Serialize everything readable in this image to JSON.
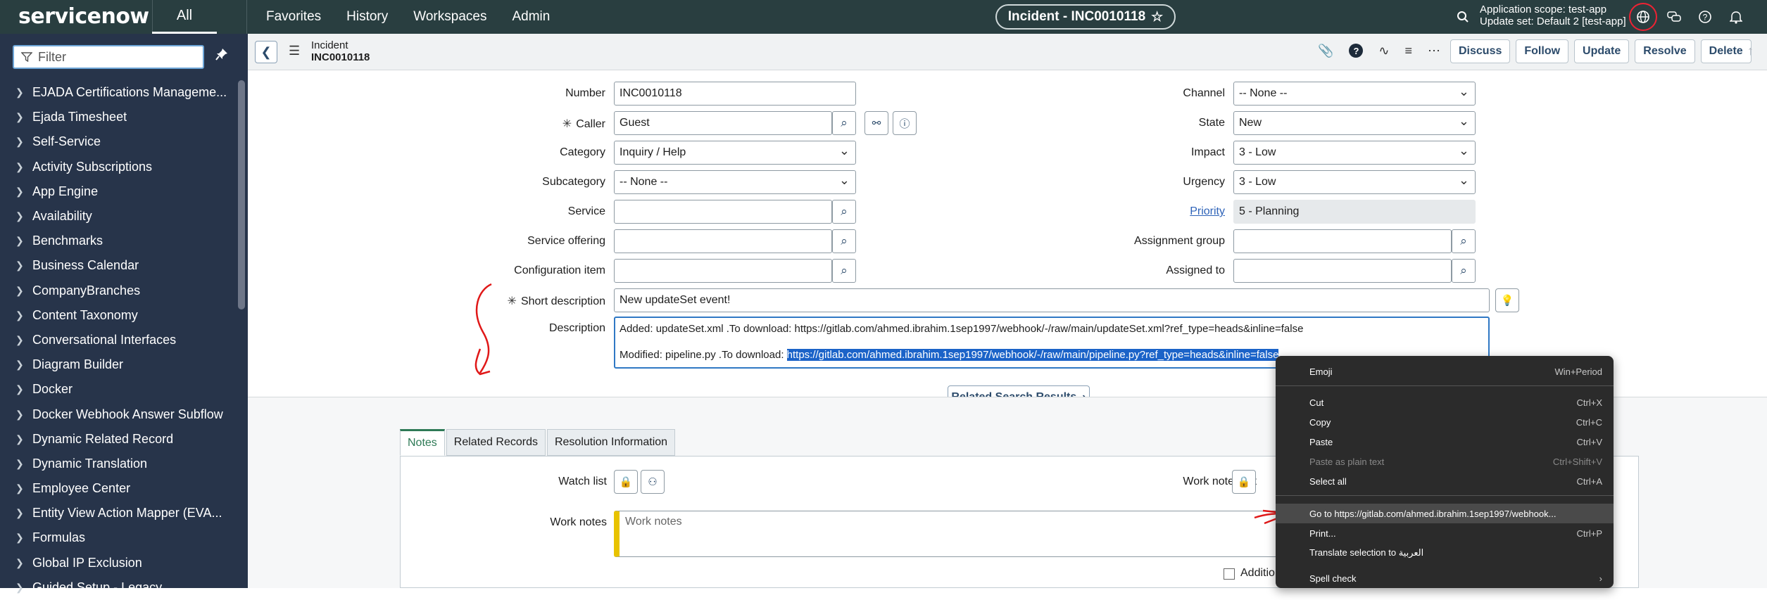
{
  "topbar": {
    "logo": "servicenow",
    "all_tab": "All",
    "nav": [
      "Favorites",
      "History",
      "Workspaces",
      "Admin"
    ],
    "record_pill": "Incident - INC0010118",
    "scope_line1": "Application scope: test-app",
    "scope_line2": "Update set: Default 2 [test-app]"
  },
  "sidebar": {
    "filter_placeholder": "Filter",
    "items": [
      "EJADA Certifications Manageme...",
      "Ejada Timesheet",
      "Self-Service",
      "Activity Subscriptions",
      "App Engine",
      "Availability",
      "Benchmarks",
      "Business Calendar",
      "CompanyBranches",
      "Content Taxonomy",
      "Conversational Interfaces",
      "Diagram Builder",
      "Docker",
      "Docker Webhook Answer Subflow",
      "Dynamic Related Record",
      "Dynamic Translation",
      "Employee Center",
      "Entity View Action Mapper (EVA...",
      "Formulas",
      "Global IP Exclusion",
      "Guided Setup - Legacy"
    ]
  },
  "form_header": {
    "type": "Incident",
    "number": "INC0010118",
    "buttons": [
      "Discuss",
      "Follow",
      "Update",
      "Resolve",
      "Delete"
    ]
  },
  "form": {
    "number_label": "Number",
    "number_value": "INC0010118",
    "caller_label": "Caller",
    "caller_value": "Guest",
    "category_label": "Category",
    "category_value": "Inquiry / Help",
    "subcategory_label": "Subcategory",
    "subcategory_value": "-- None --",
    "service_label": "Service",
    "service_value": "",
    "service_offering_label": "Service offering",
    "service_offering_value": "",
    "ci_label": "Configuration item",
    "ci_value": "",
    "channel_label": "Channel",
    "channel_value": "-- None --",
    "state_label": "State",
    "state_value": "New",
    "impact_label": "Impact",
    "impact_value": "3 - Low",
    "urgency_label": "Urgency",
    "urgency_value": "3 - Low",
    "priority_label": "Priority",
    "priority_value": "5 - Planning",
    "assignment_group_label": "Assignment group",
    "assignment_group_value": "",
    "assigned_to_label": "Assigned to",
    "assigned_to_value": "",
    "short_desc_label": "Short description",
    "short_desc_value": "New updateSet event!",
    "description_label": "Description",
    "description_line1": "Added: updateSet.xml .To download: https://gitlab.com/ahmed.ibrahim.1sep1997/webhook/-/raw/main/updateSet.xml?ref_type=heads&inline=false",
    "description_line2_prefix": "Modified: pipeline.py .To download: ",
    "description_line2_link": "https://gitlab.com/ahmed.ibrahim.1sep1997/webhook/-/raw/main/pipeline.py?ref_type=heads&inline=false"
  },
  "related_search": "Related Search Results",
  "tabs": [
    "Notes",
    "Related Records",
    "Resolution Information"
  ],
  "notes": {
    "watch_list_label": "Watch list",
    "work_notes_list_label": "Work notes list",
    "work_notes_label": "Work notes",
    "work_notes_placeholder": "Work notes",
    "additional_label": "Additio"
  },
  "context_menu": {
    "emoji": "Emoji",
    "emoji_sc": "Win+Period",
    "cut": "Cut",
    "cut_sc": "Ctrl+X",
    "copy": "Copy",
    "copy_sc": "Ctrl+C",
    "paste": "Paste",
    "paste_sc": "Ctrl+V",
    "paste_plain": "Paste as plain text",
    "paste_plain_sc": "Ctrl+Shift+V",
    "select_all": "Select all",
    "select_all_sc": "Ctrl+A",
    "goto": "Go to https://gitlab.com/ahmed.ibrahim.1sep1997/webhook...",
    "print": "Print...",
    "print_sc": "Ctrl+P",
    "translate": "Translate selection to العربية",
    "spell": "Spell check",
    "spell_sc": "›"
  }
}
